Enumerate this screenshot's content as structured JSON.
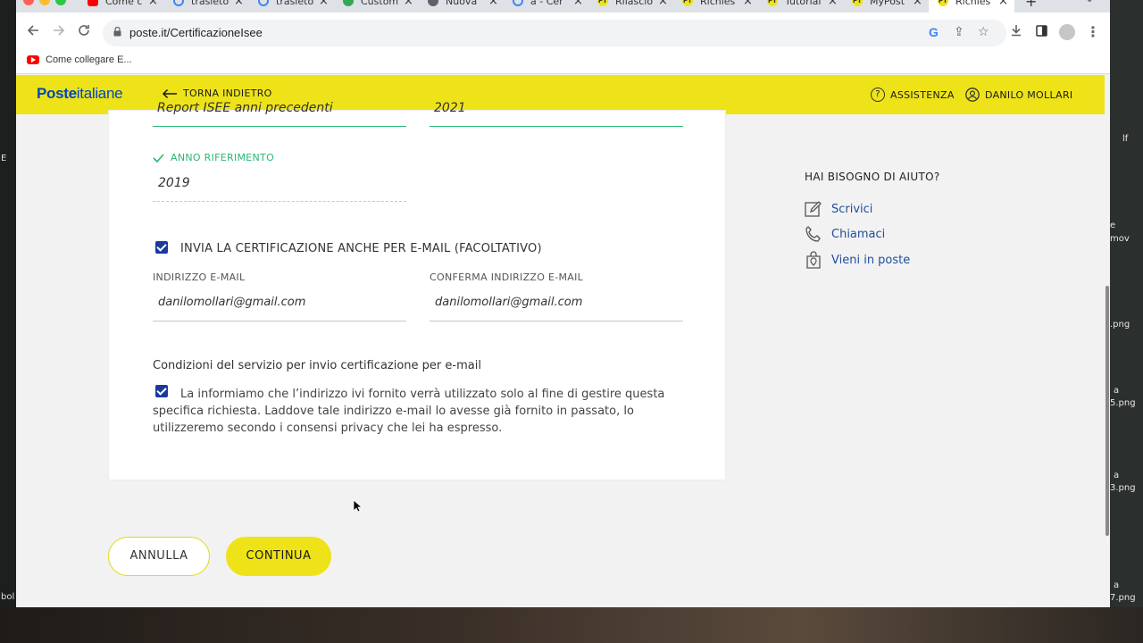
{
  "desktop": {
    "right_labels": [
      "lf",
      "e",
      "mov",
      ".png",
      "a",
      "5.png",
      "a",
      "3.png",
      "a",
      "7.png"
    ],
    "left_labels": [
      "E",
      "bol"
    ]
  },
  "browser": {
    "tabs": [
      {
        "label": "Come c",
        "icon": "youtube-icon"
      },
      {
        "label": "trasleto",
        "icon": "google-icon"
      },
      {
        "label": "trasleto",
        "icon": "google-icon"
      },
      {
        "label": "Custom",
        "icon": "extension-icon"
      },
      {
        "label": "Nuova",
        "icon": "chrome-icon"
      },
      {
        "label": "a - Cer",
        "icon": "google-icon"
      },
      {
        "label": "Rilascio",
        "icon": "poste-icon",
        "badge": "PT"
      },
      {
        "label": "Richies",
        "icon": "poste-icon",
        "badge": "PT"
      },
      {
        "label": "Tutorial",
        "icon": "poste-icon",
        "badge": "PT"
      },
      {
        "label": "MyPost",
        "icon": "poste-icon",
        "badge": "PT"
      },
      {
        "label": "Richies",
        "icon": "poste-icon",
        "badge": "PT",
        "active": true
      }
    ],
    "new_tab": "+",
    "url": "poste.it/CertificazioneIsee",
    "bookmark": "Come collegare E..."
  },
  "header": {
    "logo_bold": "Poste",
    "logo_regular": "italiane",
    "back_label": "TORNA INDIETRO",
    "assistance_label": "ASSISTENZA",
    "user_label": "DANILO MOLLARI"
  },
  "form": {
    "cutoff_left": "Report ISEE anni precedenti",
    "cutoff_right": "2021",
    "anno_label": "ANNO RIFERIMENTO",
    "anno_value": "2019",
    "email_checkbox_label": "INVIA LA CERTIFICAZIONE ANCHE PER E-MAIL (FACOLTATIVO)",
    "email_label": "INDIRIZZO E-MAIL",
    "email_value": "danilomollari@gmail.com",
    "confirm_label": "CONFERMA INDIRIZZO E-MAIL",
    "confirm_value": "danilomollari@gmail.com",
    "conditions_title": "Condizioni del servizio per invio certificazione per e-mail",
    "conditions_line1": "La informiamo che l’indirizzo ivi fornito verrà utilizzato solo al fine di gestire questa",
    "conditions_line2": "specifica richiesta. Laddove tale indirizzo e-mail lo avesse già fornito in passato, lo",
    "conditions_line3": "utilizzeremo secondo i consensi privacy che lei ha espresso."
  },
  "help": {
    "title": "HAI BISOGNO DI AIUTO?",
    "items": [
      {
        "label": "Scrivici",
        "icon": "pencil-icon"
      },
      {
        "label": "Chiamaci",
        "icon": "phone-icon"
      },
      {
        "label": "Vieni in poste",
        "icon": "location-bag-icon"
      }
    ]
  },
  "actions": {
    "cancel": "ANNULLA",
    "continue": "CONTINUA"
  },
  "colors": {
    "brand_yellow": "#eee318",
    "brand_blue": "#0047bb",
    "valid_green": "#2bb673",
    "checkbox_blue": "#1a3a9e",
    "link_blue": "#1d4fa0"
  }
}
